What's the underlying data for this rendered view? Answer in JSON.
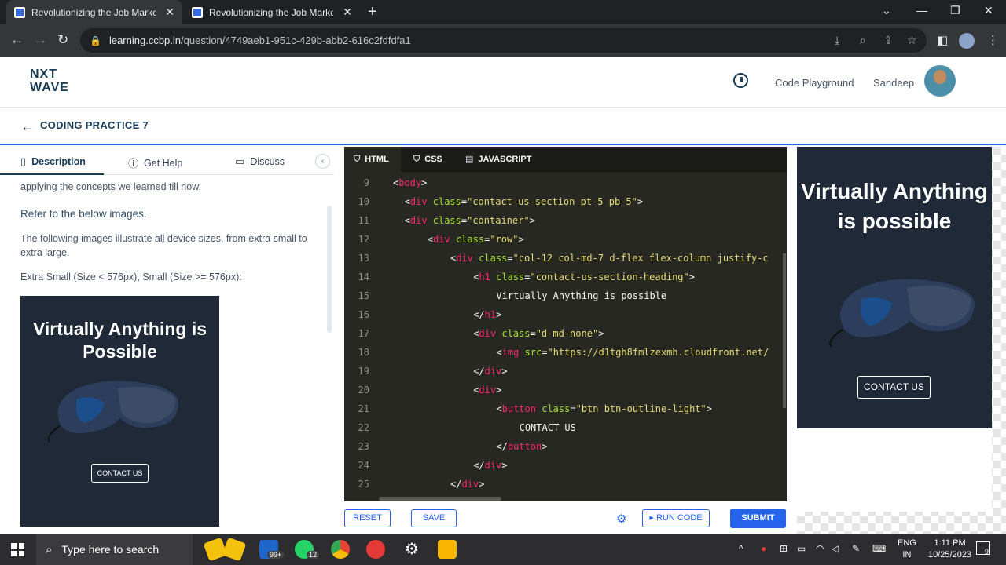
{
  "browser": {
    "tabs": [
      {
        "title": "Revolutionizing the Job Market | N",
        "active": true
      },
      {
        "title": "Revolutionizing the Job Market | N",
        "active": false
      }
    ],
    "url_host": "learning.ccbp.in",
    "url_path": "/question/4749aeb1-951c-429b-abb2-616c2fdfdfa1"
  },
  "header": {
    "logo_line1": "NXT",
    "logo_line2": "WAVE",
    "code_playground": "Code Playground",
    "user_name": "Sandeep"
  },
  "practice": {
    "title": "CODING PRACTICE 7"
  },
  "left_panel": {
    "tabs": {
      "description": "Description",
      "get_help": "Get Help",
      "discuss": "Discuss"
    },
    "text_top": "applying the concepts we learned till now.",
    "refer_heading": "Refer to the below images.",
    "paragraph": "The following images illustrate all device sizes, from extra small to extra large.",
    "size_label": "Extra Small (Size < 576px), Small (Size >= 576px):",
    "preview_heading": "Virtually Anything is Possible",
    "preview_button": "CONTACT US"
  },
  "editor": {
    "tabs": {
      "html": "HTML",
      "css": "CSS",
      "js": "JAVASCRIPT"
    },
    "line_numbers": [
      "9",
      "10",
      "11",
      "12",
      "13",
      "14",
      "15",
      "16",
      "17",
      "18",
      "19",
      "20",
      "21",
      "22",
      "23",
      "24",
      "25"
    ],
    "lines": [
      {
        "indent": 0,
        "parts": [
          [
            "pun",
            "<"
          ],
          [
            "tag",
            "body"
          ],
          [
            "pun",
            ">"
          ]
        ]
      },
      {
        "indent": 2,
        "parts": [
          [
            "pun",
            "<"
          ],
          [
            "tag",
            "div"
          ],
          [
            "pun",
            " "
          ],
          [
            "attr",
            "class"
          ],
          [
            "pun",
            "="
          ],
          [
            "str",
            "\"contact-us-section pt-5 pb-5\""
          ],
          [
            "pun",
            ">"
          ]
        ]
      },
      {
        "indent": 2,
        "parts": [
          [
            "pun",
            "<"
          ],
          [
            "tag",
            "div"
          ],
          [
            "pun",
            " "
          ],
          [
            "attr",
            "class"
          ],
          [
            "pun",
            "="
          ],
          [
            "str",
            "\"container\""
          ],
          [
            "pun",
            ">"
          ]
        ]
      },
      {
        "indent": 6,
        "parts": [
          [
            "pun",
            "<"
          ],
          [
            "tag",
            "div"
          ],
          [
            "pun",
            " "
          ],
          [
            "attr",
            "class"
          ],
          [
            "pun",
            "="
          ],
          [
            "str",
            "\"row\""
          ],
          [
            "pun",
            ">"
          ]
        ]
      },
      {
        "indent": 10,
        "parts": [
          [
            "pun",
            "<"
          ],
          [
            "tag",
            "div"
          ],
          [
            "pun",
            " "
          ],
          [
            "attr",
            "class"
          ],
          [
            "pun",
            "="
          ],
          [
            "str",
            "\"col-12 col-md-7 d-flex flex-column justify-c"
          ]
        ]
      },
      {
        "indent": 14,
        "parts": [
          [
            "pun",
            "<"
          ],
          [
            "tag",
            "h1"
          ],
          [
            "pun",
            " "
          ],
          [
            "attr",
            "class"
          ],
          [
            "pun",
            "="
          ],
          [
            "str",
            "\"contact-us-section-heading\""
          ],
          [
            "pun",
            ">"
          ]
        ]
      },
      {
        "indent": 18,
        "parts": [
          [
            "pun",
            "Virtually Anything is possible"
          ]
        ]
      },
      {
        "indent": 14,
        "parts": [
          [
            "pun",
            "</"
          ],
          [
            "tag",
            "h1"
          ],
          [
            "pun",
            ">"
          ]
        ]
      },
      {
        "indent": 14,
        "parts": [
          [
            "pun",
            "<"
          ],
          [
            "tag",
            "div"
          ],
          [
            "pun",
            " "
          ],
          [
            "attr",
            "class"
          ],
          [
            "pun",
            "="
          ],
          [
            "str",
            "\"d-md-none\""
          ],
          [
            "pun",
            ">"
          ]
        ]
      },
      {
        "indent": 18,
        "parts": [
          [
            "pun",
            "<"
          ],
          [
            "tag",
            "img"
          ],
          [
            "pun",
            " "
          ],
          [
            "attr",
            "src"
          ],
          [
            "pun",
            "="
          ],
          [
            "str",
            "\"https://d1tgh8fmlzexmh.cloudfront.net/"
          ]
        ]
      },
      {
        "indent": 14,
        "parts": [
          [
            "pun",
            "</"
          ],
          [
            "tag",
            "div"
          ],
          [
            "pun",
            ">"
          ]
        ]
      },
      {
        "indent": 14,
        "parts": [
          [
            "pun",
            "<"
          ],
          [
            "tag",
            "div"
          ],
          [
            "pun",
            ">"
          ]
        ]
      },
      {
        "indent": 18,
        "parts": [
          [
            "pun",
            "<"
          ],
          [
            "tag",
            "button"
          ],
          [
            "pun",
            " "
          ],
          [
            "attr",
            "class"
          ],
          [
            "pun",
            "="
          ],
          [
            "str",
            "\"btn btn-outline-light\""
          ],
          [
            "pun",
            ">"
          ]
        ]
      },
      {
        "indent": 22,
        "parts": [
          [
            "pun",
            "CONTACT US"
          ]
        ]
      },
      {
        "indent": 18,
        "parts": [
          [
            "pun",
            "</"
          ],
          [
            "tag",
            "button"
          ],
          [
            "pun",
            ">"
          ]
        ]
      },
      {
        "indent": 14,
        "parts": [
          [
            "pun",
            "</"
          ],
          [
            "tag",
            "div"
          ],
          [
            "pun",
            ">"
          ]
        ]
      },
      {
        "indent": 10,
        "parts": [
          [
            "pun",
            "</"
          ],
          [
            "tag",
            "div"
          ],
          [
            "pun",
            ">"
          ]
        ]
      }
    ]
  },
  "output": {
    "heading": "Virtually Anything is possible",
    "button": "CONTACT US"
  },
  "actions": {
    "reset": "RESET",
    "save": "SAVE",
    "run": "RUN CODE",
    "submit": "SUBMIT"
  },
  "taskbar": {
    "search_placeholder": "Type here to search",
    "mail_badge": "99+",
    "whatsapp_badge": "12",
    "lang_line1": "ENG",
    "lang_line2": "IN",
    "time": "1:11 PM",
    "date": "10/25/2023",
    "notifications": "9"
  }
}
